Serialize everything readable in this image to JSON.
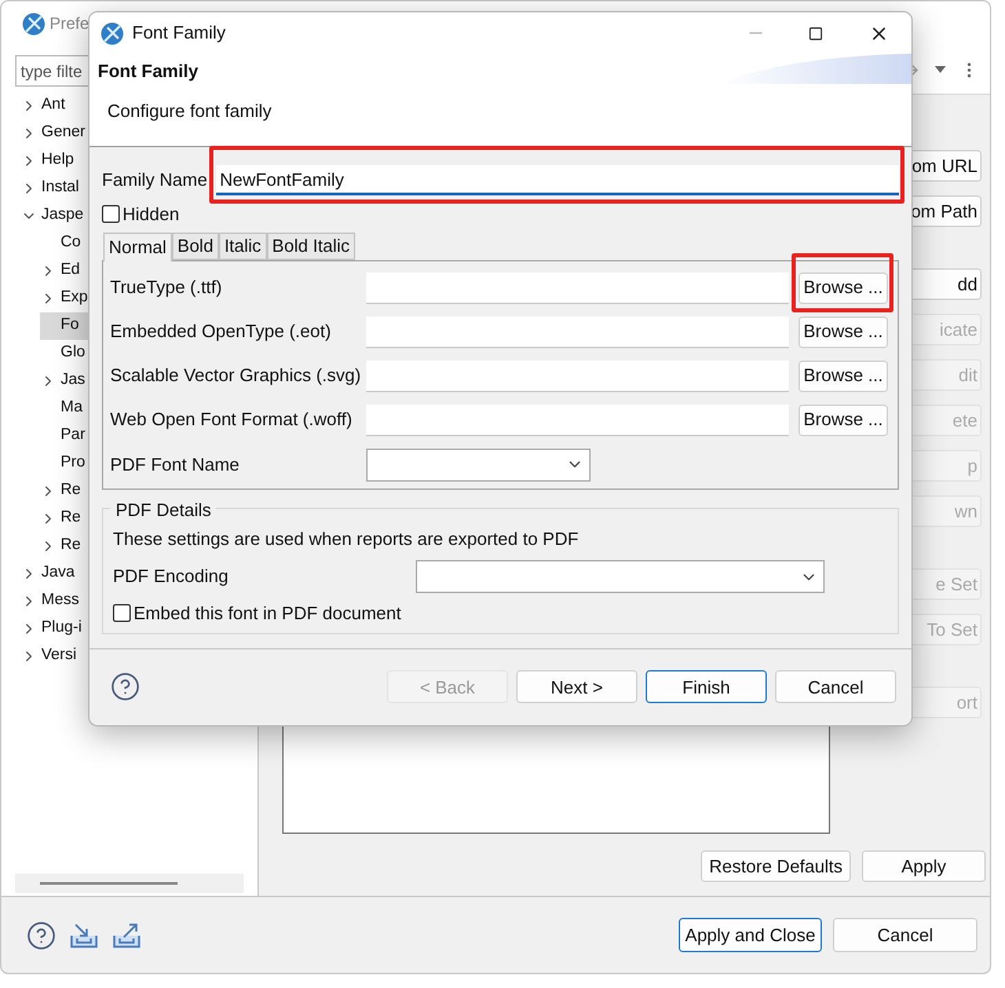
{
  "background_window": {
    "title": "Prefe",
    "filter": {
      "placeholder": "type filte"
    },
    "tree": [
      {
        "label": "Ant",
        "expanded": false,
        "selected": false
      },
      {
        "label": "Gener",
        "expanded": false,
        "selected": false
      },
      {
        "label": "Help",
        "expanded": false,
        "selected": false
      },
      {
        "label": "Instal",
        "expanded": false,
        "selected": false
      },
      {
        "label": "Jaspe",
        "expanded": true,
        "selected": false,
        "children": [
          {
            "label": "Co",
            "selected": false
          },
          {
            "label": "Ed",
            "expanded": false,
            "selected": false
          },
          {
            "label": "Exp",
            "expanded": false,
            "selected": false
          },
          {
            "label": "Fo",
            "selected": true
          },
          {
            "label": "Glo",
            "selected": false
          },
          {
            "label": "Jas",
            "expanded": false,
            "selected": false
          },
          {
            "label": "Ma",
            "selected": false
          },
          {
            "label": "Par",
            "selected": false
          },
          {
            "label": "Pro",
            "selected": false
          },
          {
            "label": "Re",
            "expanded": false,
            "selected": false
          },
          {
            "label": "Re",
            "expanded": false,
            "selected": false
          },
          {
            "label": "Re",
            "expanded": false,
            "selected": false
          }
        ]
      },
      {
        "label": "Java",
        "expanded": false,
        "selected": false
      },
      {
        "label": "Mess",
        "expanded": false,
        "selected": false
      },
      {
        "label": "Plug-i",
        "expanded": false,
        "selected": false
      },
      {
        "label": "Versi",
        "expanded": false,
        "selected": false
      }
    ],
    "side_button_groups": [
      [
        {
          "label": "om URL",
          "disabled": false
        },
        {
          "label": "om Path",
          "disabled": false
        }
      ],
      [
        {
          "label": "dd",
          "disabled": false
        },
        {
          "label": "icate",
          "disabled": true
        },
        {
          "label": "dit",
          "disabled": true
        },
        {
          "label": "ete",
          "disabled": true
        },
        {
          "label": "p",
          "disabled": true
        },
        {
          "label": "wn",
          "disabled": true
        }
      ],
      [
        {
          "label": "e Set",
          "disabled": true
        },
        {
          "label": "To Set",
          "disabled": true
        }
      ],
      [
        {
          "label": "ort",
          "disabled": true
        }
      ]
    ],
    "restore_defaults": "Restore Defaults",
    "apply": "Apply",
    "apply_and_close": "Apply and Close",
    "cancel": "Cancel"
  },
  "dialog": {
    "title": "Font Family",
    "heading": "Font Family",
    "description": "Configure font family",
    "family_name": {
      "label": "Family Name",
      "value": "NewFontFamily",
      "focused": true,
      "highlighted": true
    },
    "hidden": {
      "label": "Hidden",
      "checked": false
    },
    "tabs": [
      {
        "label": "Normal",
        "selected": true
      },
      {
        "label": "Bold",
        "selected": false
      },
      {
        "label": "Italic",
        "selected": false
      },
      {
        "label": "Bold Italic",
        "selected": false
      }
    ],
    "font_files": [
      {
        "label": "TrueType (.ttf)",
        "button": "Browse ...",
        "highlighted": true
      },
      {
        "label": "Embedded OpenType (.eot)",
        "button": "Browse ...",
        "highlighted": false
      },
      {
        "label": "Scalable Vector Graphics (.svg)",
        "button": "Browse ...",
        "highlighted": false
      },
      {
        "label": "Web Open Font Format (.woff)",
        "button": "Browse ...",
        "highlighted": false
      }
    ],
    "pdf_font_name": {
      "label": "PDF Font Name"
    },
    "pdf_details": {
      "legend": "PDF Details",
      "description": "These settings are used when reports are exported to PDF",
      "encoding_label": "PDF Encoding",
      "embed": {
        "label": "Embed this font in PDF document",
        "checked": false
      }
    },
    "buttons": [
      {
        "label": "< Back",
        "disabled": true,
        "default": false
      },
      {
        "label": "Next >",
        "disabled": false,
        "default": false
      },
      {
        "label": "Finish",
        "disabled": false,
        "default": true
      },
      {
        "label": "Cancel",
        "disabled": false,
        "default": false
      }
    ]
  }
}
